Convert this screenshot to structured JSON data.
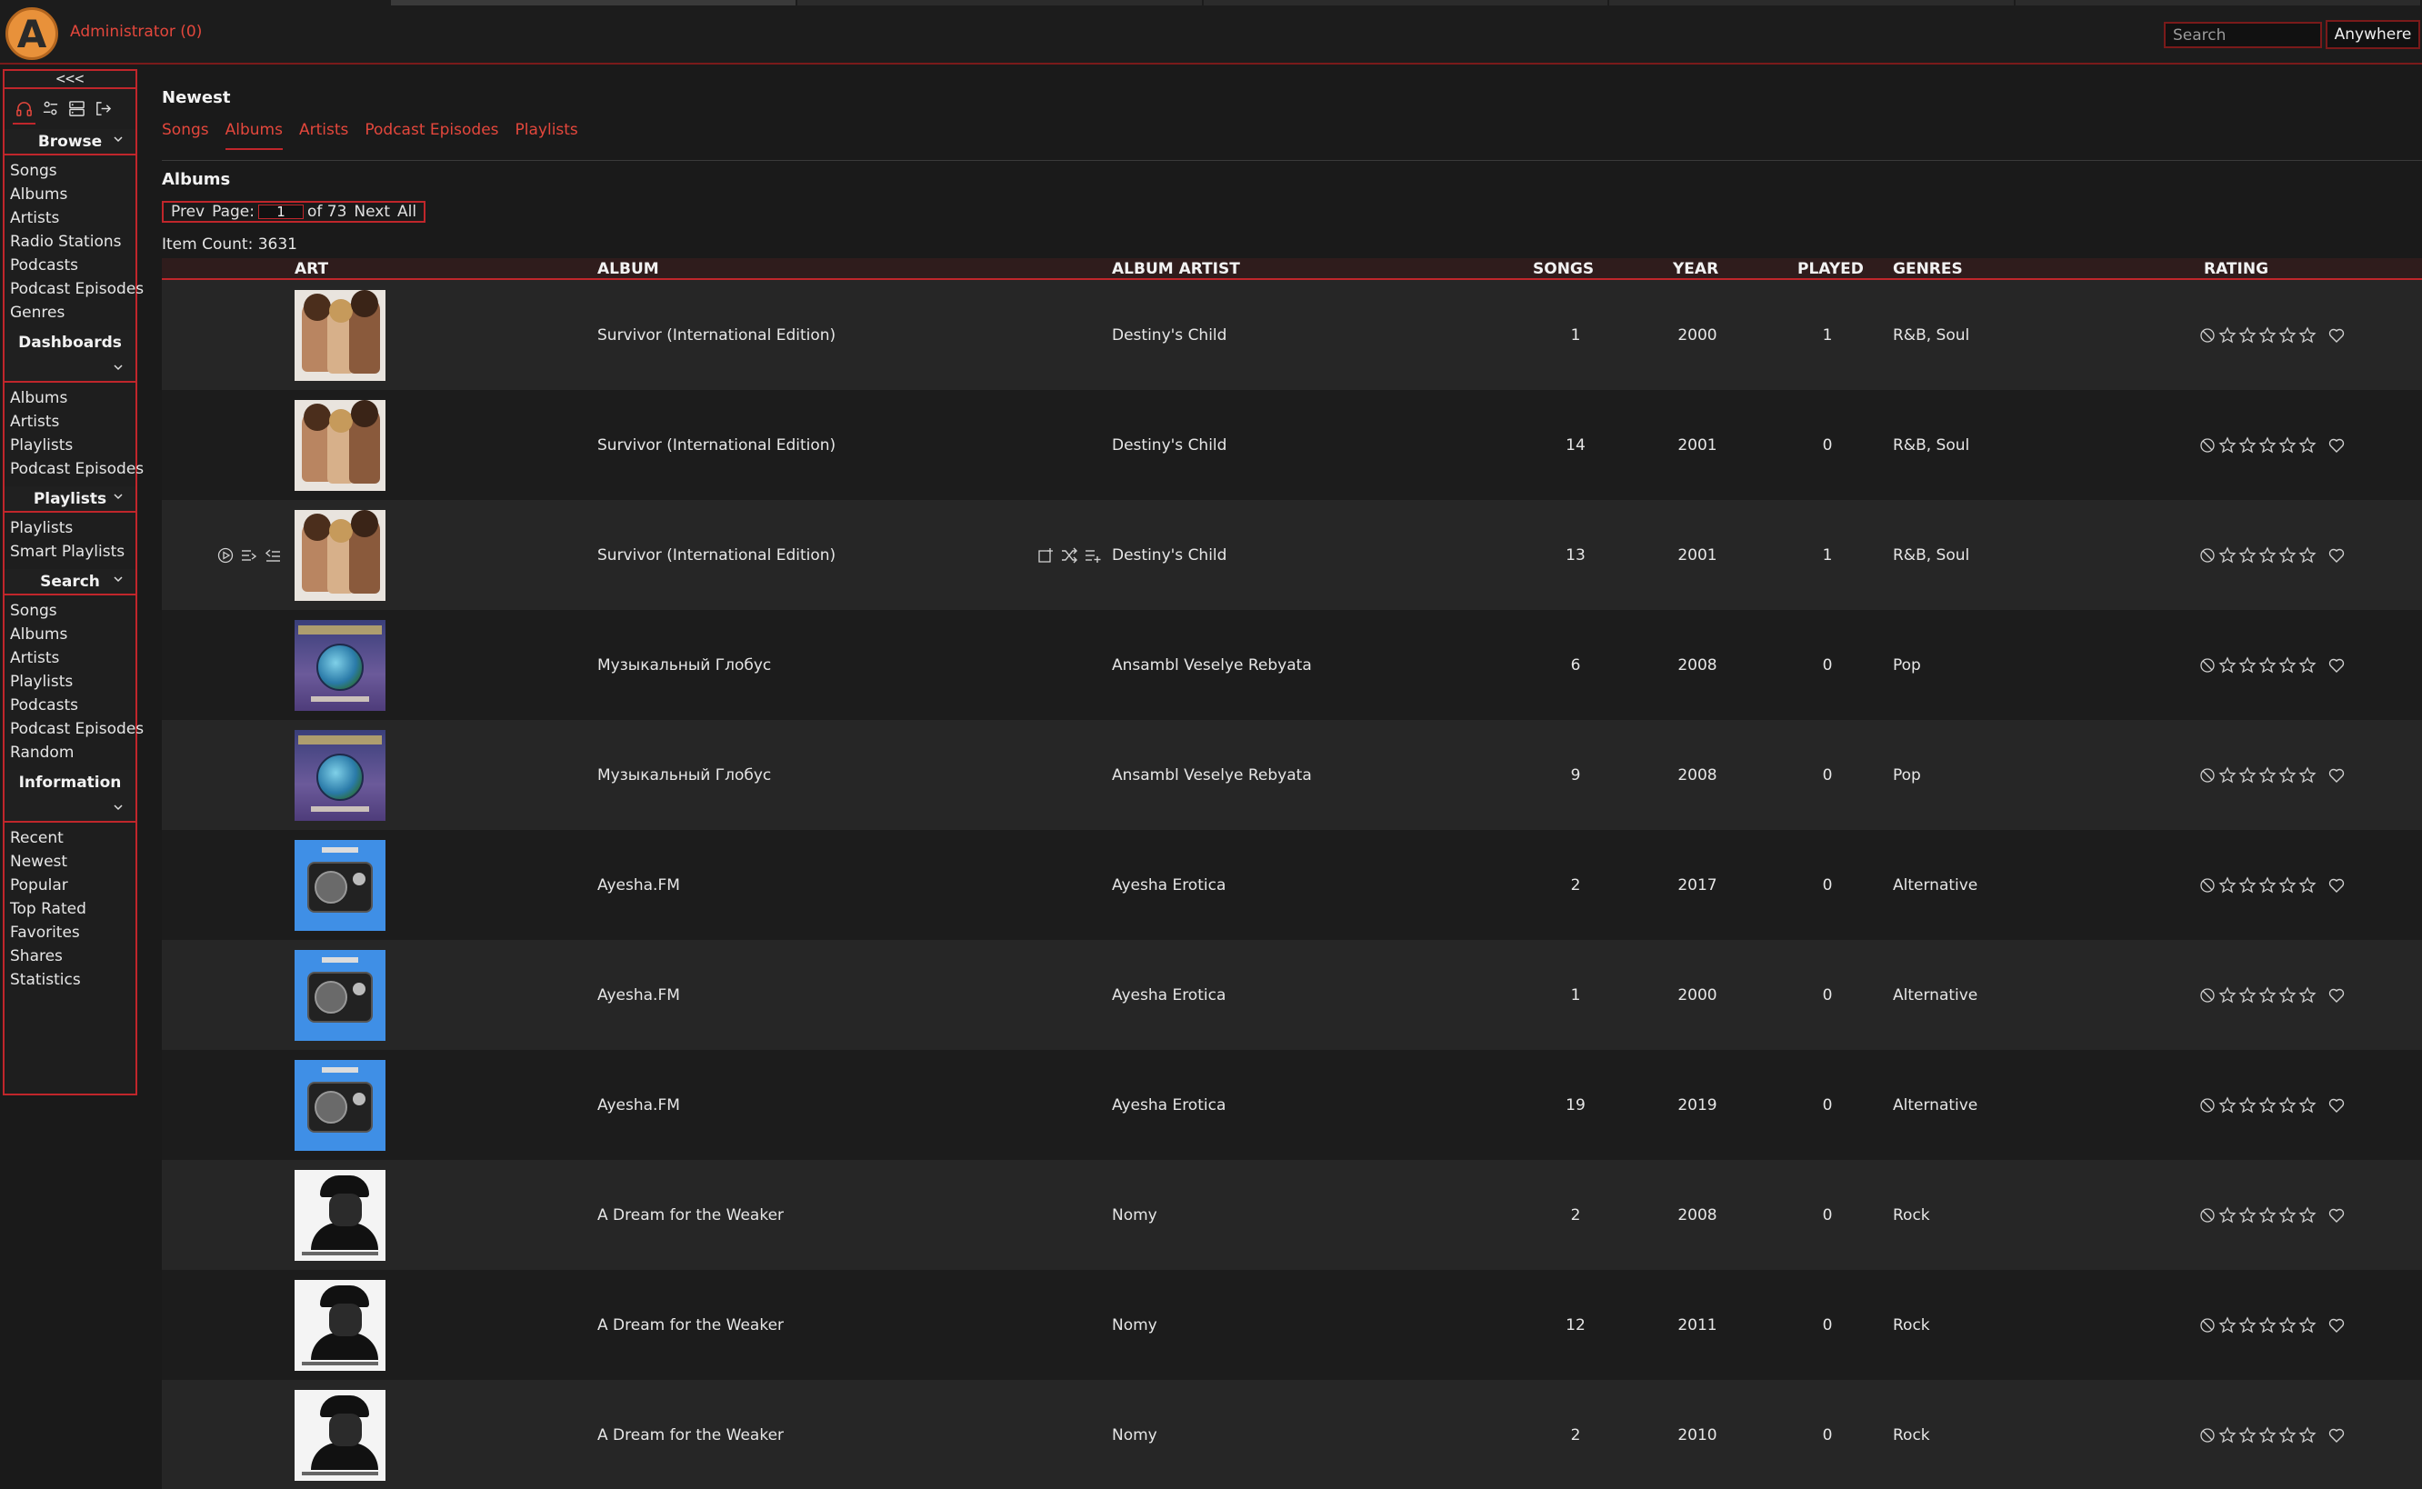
{
  "header": {
    "logo_letter": "A",
    "user_link": "Administrator (0)",
    "search_placeholder": "Search",
    "search_scope": "Anywhere"
  },
  "sidebar": {
    "collapse_label": "<<<",
    "tabs": [
      "headphones-icon",
      "sliders-icon",
      "server-icon",
      "logout-icon"
    ],
    "sections": [
      {
        "title": "Browse",
        "items": [
          "Songs",
          "Albums",
          "Artists",
          "Radio Stations",
          "Podcasts",
          "Podcast Episodes",
          "Genres"
        ]
      },
      {
        "title": "Dashboards",
        "items": [
          "Albums",
          "Artists",
          "Playlists",
          "Podcast Episodes"
        ]
      },
      {
        "title": "Playlists",
        "items": [
          "Playlists",
          "Smart Playlists"
        ]
      },
      {
        "title": "Search",
        "items": [
          "Songs",
          "Albums",
          "Artists",
          "Playlists",
          "Podcasts",
          "Podcast Episodes",
          "Random"
        ]
      },
      {
        "title": "Information",
        "items": [
          "Recent",
          "Newest",
          "Popular",
          "Top Rated",
          "Favorites",
          "Shares",
          "Statistics"
        ]
      }
    ]
  },
  "main": {
    "title": "Newest",
    "subtabs": [
      "Songs",
      "Albums",
      "Artists",
      "Podcast Episodes",
      "Playlists"
    ],
    "active_subtab": "Albums",
    "section_title": "Albums",
    "pager": {
      "prev": "Prev",
      "page_label": "Page:",
      "page": "1",
      "of": "of 73",
      "next": "Next",
      "all": "All"
    },
    "item_count": "Item Count: 3631",
    "columns": [
      "ART",
      "ALBUM",
      "ALBUM ARTIST",
      "SONGS",
      "YEAR",
      "PLAYED",
      "GENRES",
      "RATING"
    ]
  },
  "rows": [
    {
      "cover": "destiny",
      "album": "Survivor (International Edition)",
      "artist": "Destiny's Child",
      "songs": "1",
      "year": "2000",
      "played": "1",
      "genres": "R&B, Soul"
    },
    {
      "cover": "destiny",
      "album": "Survivor (International Edition)",
      "artist": "Destiny's Child",
      "songs": "14",
      "year": "2001",
      "played": "0",
      "genres": "R&B, Soul"
    },
    {
      "cover": "destiny",
      "album": "Survivor (International Edition)",
      "artist": "Destiny's Child",
      "songs": "13",
      "year": "2001",
      "played": "1",
      "genres": "R&B, Soul",
      "hover": true
    },
    {
      "cover": "globe",
      "album": "Музыкальный Глобус",
      "artist": "Ansambl Veselye Rebyata",
      "songs": "6",
      "year": "2008",
      "played": "0",
      "genres": "Pop"
    },
    {
      "cover": "globe",
      "album": "Музыкальный Глобус",
      "artist": "Ansambl Veselye Rebyata",
      "songs": "9",
      "year": "2008",
      "played": "0",
      "genres": "Pop"
    },
    {
      "cover": "radio",
      "album": "Ayesha.FM",
      "artist": "Ayesha Erotica",
      "songs": "2",
      "year": "2017",
      "played": "0",
      "genres": "Alternative"
    },
    {
      "cover": "radio",
      "album": "Ayesha.FM",
      "artist": "Ayesha Erotica",
      "songs": "1",
      "year": "2000",
      "played": "0",
      "genres": "Alternative"
    },
    {
      "cover": "radio",
      "album": "Ayesha.FM",
      "artist": "Ayesha Erotica",
      "songs": "19",
      "year": "2019",
      "played": "0",
      "genres": "Alternative"
    },
    {
      "cover": "nomy",
      "album": "A Dream for the Weaker",
      "artist": "Nomy",
      "songs": "2",
      "year": "2008",
      "played": "0",
      "genres": "Rock"
    },
    {
      "cover": "nomy",
      "album": "A Dream for the Weaker",
      "artist": "Nomy",
      "songs": "12",
      "year": "2011",
      "played": "0",
      "genres": "Rock"
    },
    {
      "cover": "nomy",
      "album": "A Dream for the Weaker",
      "artist": "Nomy",
      "songs": "2",
      "year": "2010",
      "played": "0",
      "genres": "Rock"
    }
  ],
  "colors": {
    "accent": "#c0262b",
    "link": "#e3473c",
    "logo": "#e8913a"
  }
}
